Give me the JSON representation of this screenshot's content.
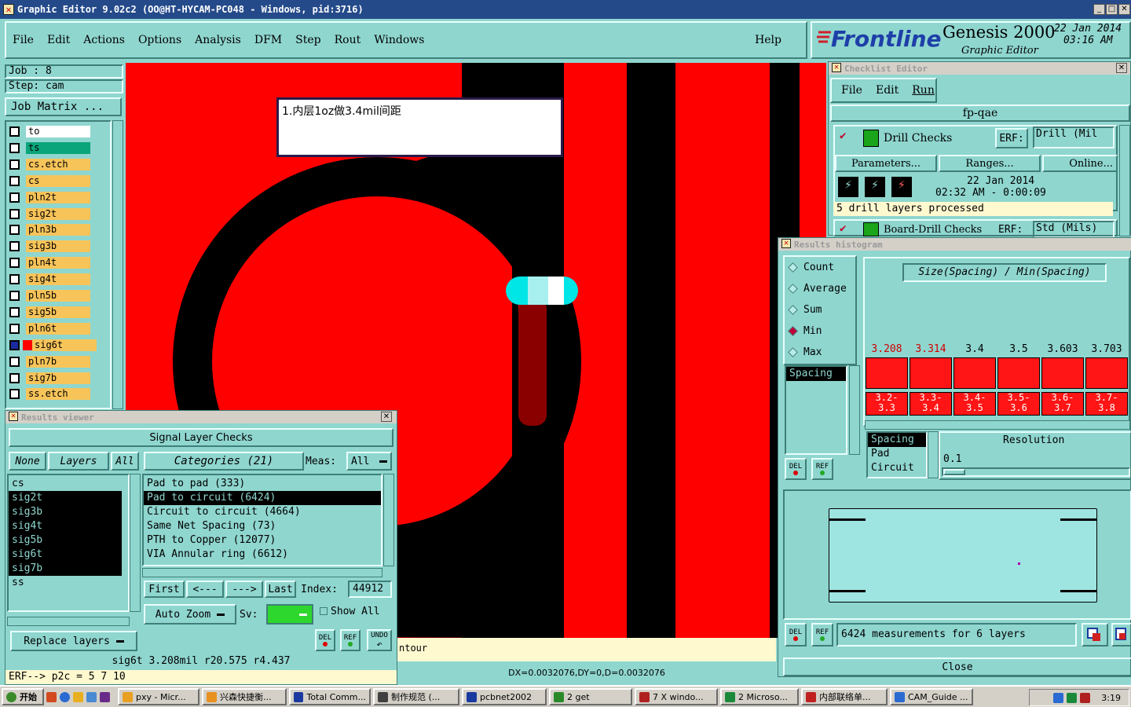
{
  "window": {
    "title": "Graphic Editor 9.02c2 (OO@HT-HYCAM-PC048 - Windows, pid:3716)"
  },
  "menubar": {
    "items": [
      "File",
      "Edit",
      "Actions",
      "Options",
      "Analysis",
      "DFM",
      "Step",
      "Rout",
      "Windows"
    ],
    "help": "Help"
  },
  "brand": {
    "logo": "Frontline",
    "product": "Genesis 2000",
    "subtitle": "Graphic Editor",
    "date": "22 Jan 2014",
    "time": "03:16 AM"
  },
  "job": {
    "job_label": "Job : 8",
    "step_label": "Step: cam",
    "matrix_button": "Job Matrix ..."
  },
  "layers": [
    {
      "name": "to",
      "color": "#ffffff"
    },
    {
      "name": "ts",
      "color": "#0aa57a"
    },
    {
      "name": "cs.etch",
      "color": "#f7c45a"
    },
    {
      "name": "cs",
      "color": "#f7c45a"
    },
    {
      "name": "pln2t",
      "color": "#f7c45a"
    },
    {
      "name": "sig2t",
      "color": "#f7c45a"
    },
    {
      "name": "pln3b",
      "color": "#f7c45a"
    },
    {
      "name": "sig3b",
      "color": "#f7c45a"
    },
    {
      "name": "pln4t",
      "color": "#f7c45a"
    },
    {
      "name": "sig4t",
      "color": "#f7c45a"
    },
    {
      "name": "pln5b",
      "color": "#f7c45a"
    },
    {
      "name": "sig5b",
      "color": "#f7c45a"
    },
    {
      "name": "pln6t",
      "color": "#f7c45a"
    },
    {
      "name": "sig6t",
      "color": "#f7c45a"
    },
    {
      "name": "pln7b",
      "color": "#f7c45a"
    },
    {
      "name": "sig7b",
      "color": "#f7c45a"
    },
    {
      "name": "ss.etch",
      "color": "#f7c45a"
    }
  ],
  "canvas": {
    "note": "1.内层1oz做3.4mil间距",
    "partial_label": "ntour",
    "coords": "DX=0.0032076,DY=0,D=0.0032076"
  },
  "results_viewer": {
    "title": "Results viewer",
    "header": "Signal Layer Checks",
    "tabs": [
      "None",
      "Layers",
      "All"
    ],
    "categories_button": "Categories (21)",
    "meas_label": "Meas:",
    "meas_value": "All",
    "layer_list": [
      "cs",
      "sig2t",
      "sig3b",
      "sig4t",
      "sig5b",
      "sig6t",
      "sig7b",
      "ss"
    ],
    "categories": [
      "Pad to pad (333)",
      "Pad to circuit (6424)",
      "Circuit to circuit (4664)",
      "Same Net Spacing (73)",
      "PTH to Copper (12077)",
      "VIA Annular ring (6612)"
    ],
    "nav": [
      "First",
      "<---",
      "--->",
      "Last"
    ],
    "index_label": "Index:",
    "index_value": "44912",
    "autozoom": "Auto Zoom",
    "sv_label": "Sv:",
    "show_all": "Show All",
    "replace_layers": "Replace layers",
    "status": "sig6t 3.208mil  r20.575  r4.437",
    "erf": "ERF--> p2c = 5 7 10",
    "del": "DEL",
    "ref": "REF",
    "undo": "UNDO"
  },
  "checklist": {
    "title": "Checklist Editor",
    "menu": [
      "File",
      "Edit",
      "Run"
    ],
    "name": "fp-qae",
    "drill_checks": "Drill Checks",
    "erf_label": "ERF:",
    "erf_value": "Drill (Mil",
    "buttons": [
      "Parameters...",
      "Ranges...",
      "Online..."
    ],
    "date": "22 Jan 2014",
    "time": "02:32 AM - 0:00:09",
    "status": "5 drill layers processed",
    "board_drill": "Board-Drill Checks",
    "erf2_value": "Std (Mils)"
  },
  "histogram": {
    "title": "Results histogram",
    "options": [
      "Count",
      "Average",
      "Sum",
      "Min",
      "Max"
    ],
    "selected_option": "Min",
    "axis_title": "Size(Spacing) / Min(Spacing)",
    "bar_values": [
      "3.208",
      "3.314",
      "3.4",
      "3.5",
      "3.603",
      "3.703"
    ],
    "bin_labels": [
      [
        "3.2-",
        "3.3"
      ],
      [
        "3.3-",
        "3.4"
      ],
      [
        "3.4-",
        "3.5"
      ],
      [
        "3.5-",
        "3.6"
      ],
      [
        "3.6-",
        "3.7"
      ],
      [
        "3.7-",
        "3.8"
      ]
    ],
    "types_list": [
      "Spacing"
    ],
    "category_list": [
      "Spacing",
      "Pad",
      "Circuit"
    ],
    "resolution_label": "Resolution",
    "resolution_value": "0.1",
    "summary": "6424 measurements for 6 layers",
    "close": "Close",
    "del": "DEL",
    "ref": "REF"
  },
  "taskbar": {
    "start": "开始",
    "items": [
      "pxy - Micr...",
      "兴森快捷衡...",
      "Total Comm...",
      "制作规范 (...",
      "pcbnet2002",
      "2 get",
      "7 X windo...",
      "2 Microso...",
      "内部联络单...",
      "CAM_Guide ..."
    ],
    "clock": "3:19"
  }
}
